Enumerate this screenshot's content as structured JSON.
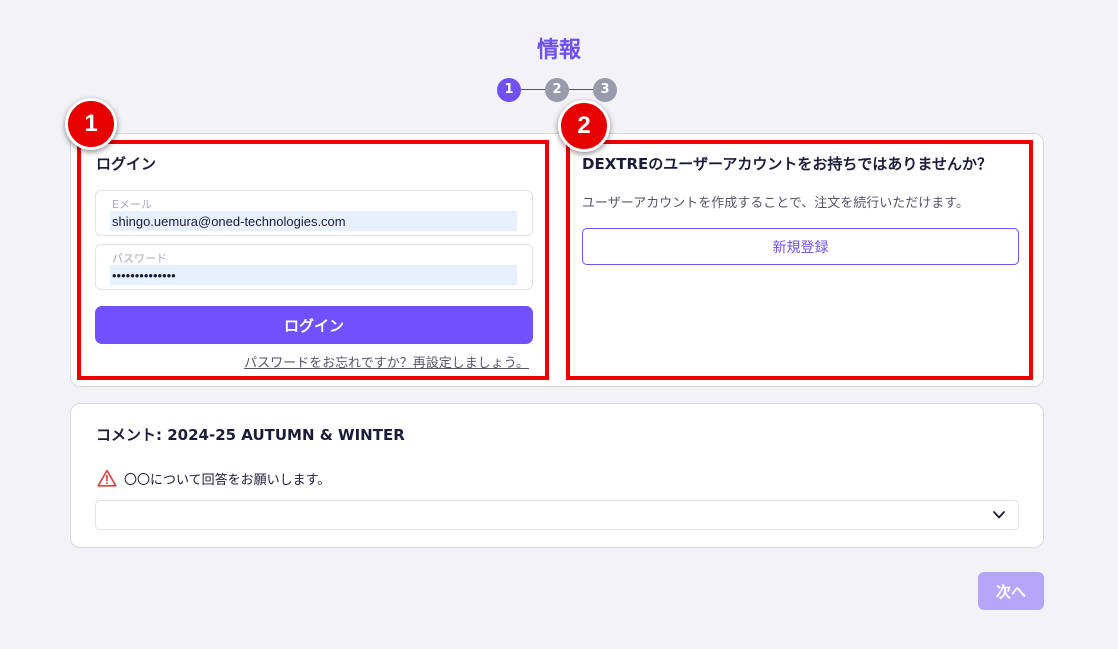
{
  "page": {
    "title": "情報"
  },
  "steps": [
    {
      "label": "1",
      "state": "active"
    },
    {
      "label": "2",
      "state": "inactive"
    },
    {
      "label": "3",
      "state": "inactive"
    }
  ],
  "markers": {
    "login": "1",
    "signup": "2"
  },
  "login": {
    "heading": "ログイン",
    "email_label": "Eメール",
    "email_value": "shingo.uemura@oned-technologies.com",
    "password_label": "パスワード",
    "password_value": "••••••••••••••",
    "button_label": "ログイン",
    "forgot_link": "パスワードをお忘れですか？再設定しましょう。"
  },
  "signup": {
    "heading": "DEXTREのユーザーアカウントをお持ちではありませんか？",
    "description": "ユーザーアカウントを作成することで、注文を続行いただけます。",
    "button_label": "新規登録"
  },
  "comment": {
    "heading": "コメント: 2024-25 AUTUMN & WINTER",
    "warning_text": "〇〇について回答をお願いします。",
    "select_value": ""
  },
  "footer": {
    "next_label": "次へ"
  },
  "colors": {
    "accent": "#7050ff",
    "accent_disabled": "#b5a6fa",
    "highlight": "#ee0000",
    "warning": "#e53e3e",
    "background": "#f2f2f7"
  }
}
